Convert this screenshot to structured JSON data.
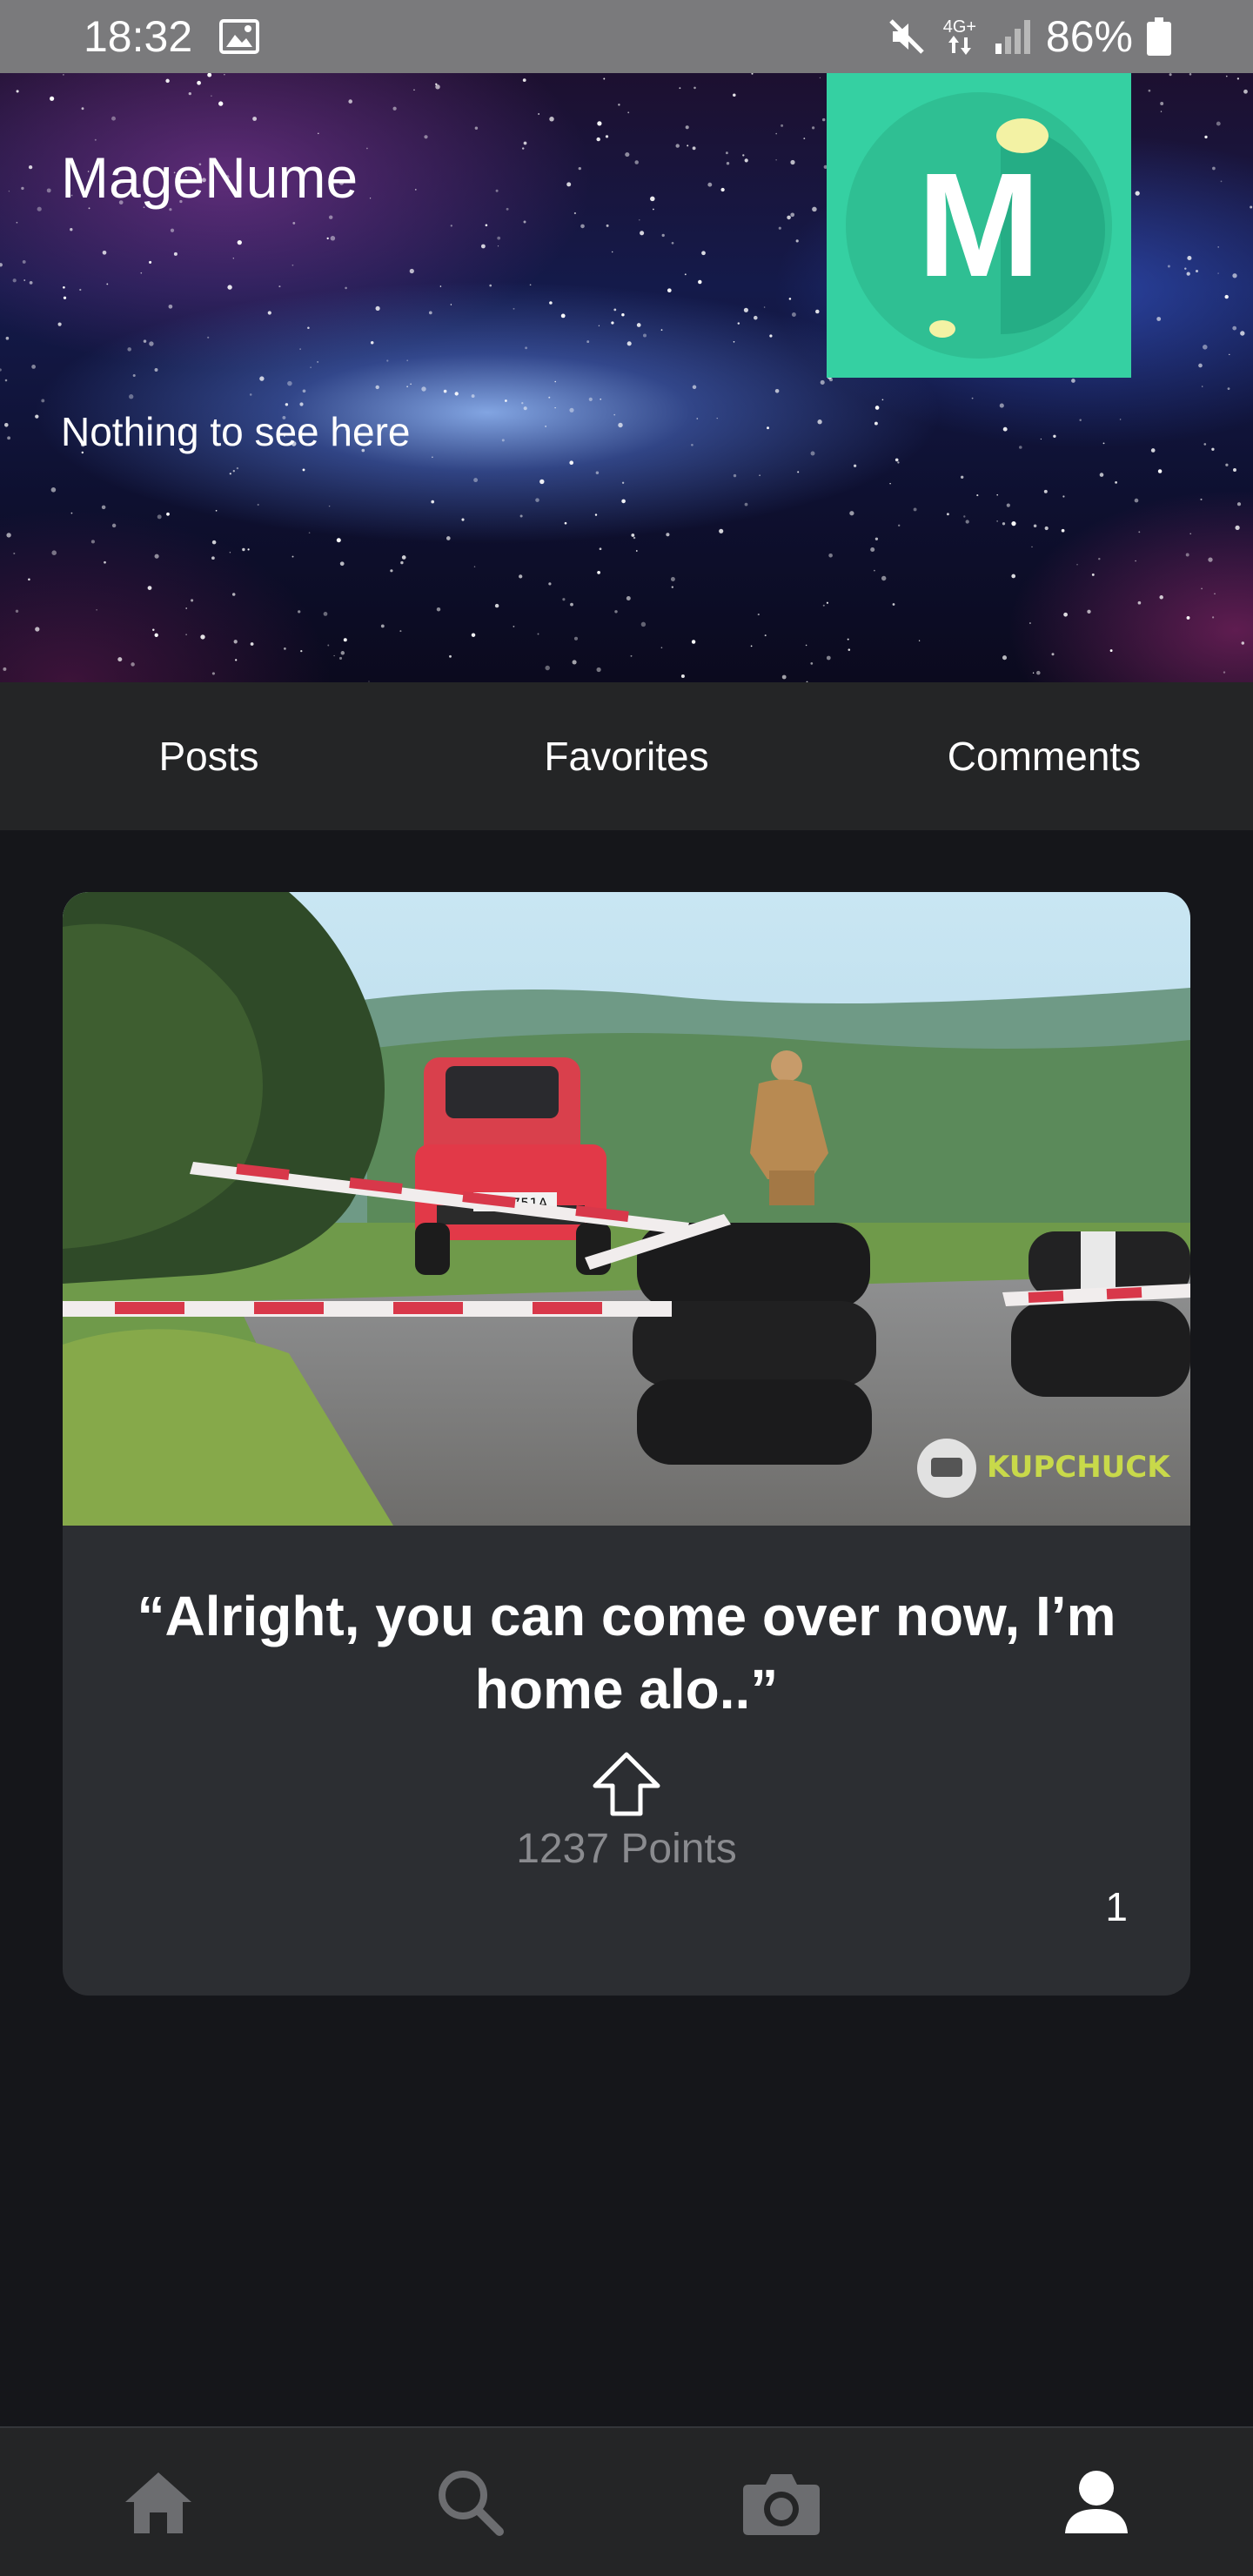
{
  "status_bar": {
    "time": "18:32",
    "network_label": "4G+",
    "battery_text": "86%"
  },
  "profile": {
    "name": "MageNume",
    "bio": "Nothing to see here",
    "avatar_letter": "M",
    "avatar_color": "#35d0a2"
  },
  "tabs": [
    {
      "label": "Posts"
    },
    {
      "label": "Favorites"
    },
    {
      "label": "Comments"
    }
  ],
  "post": {
    "title": "“Alright, you can come over now, I’m home alo..”",
    "points": "1237 Points",
    "comment_count": "1",
    "image_watermark": "KUPCHUCK",
    "image_plate": "BBL 751A"
  },
  "bottom_nav": [
    {
      "icon": "home-icon"
    },
    {
      "icon": "search-icon"
    },
    {
      "icon": "camera-icon"
    },
    {
      "icon": "profile-icon",
      "active": true
    }
  ]
}
